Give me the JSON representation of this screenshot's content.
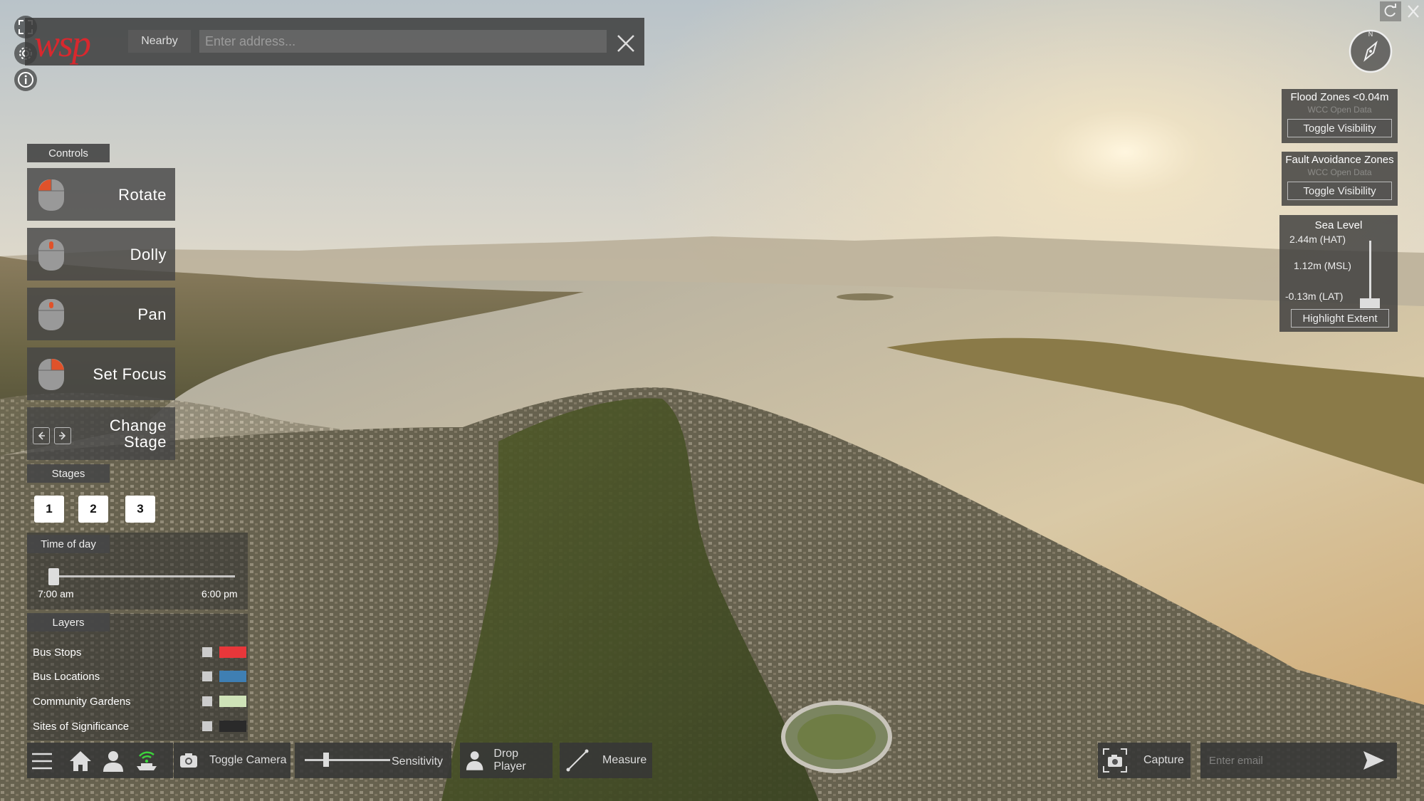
{
  "search": {
    "logo_text": "wsp",
    "nearby_label": "Nearby",
    "address_placeholder": "Enter address..."
  },
  "controls": {
    "section_label": "Controls",
    "items": [
      {
        "label": "Rotate"
      },
      {
        "label": "Dolly"
      },
      {
        "label": "Pan"
      },
      {
        "label": "Set Focus"
      },
      {
        "label_line1": "Change",
        "label_line2": "Stage"
      }
    ]
  },
  "stages": {
    "section_label": "Stages",
    "buttons": [
      "1",
      "2",
      "3"
    ]
  },
  "time_of_day": {
    "section_label": "Time of day",
    "start_label": "7:00 am",
    "end_label": "6:00 pm",
    "value_fraction": 0.0
  },
  "layers": {
    "section_label": "Layers",
    "items": [
      {
        "name": "Bus Stops",
        "color": "#e8373a"
      },
      {
        "name": "Bus Locations",
        "color": "#3f7fb3"
      },
      {
        "name": "Community Gardens",
        "color": "#cfe3b8"
      },
      {
        "name": "Sites of Significance",
        "color": "#2a2a2a"
      }
    ]
  },
  "toolbar": {
    "toggle_camera_label": "Toggle Camera",
    "sensitivity_label": "Sensitivity",
    "sensitivity_fraction": 0.25,
    "drop_player_label": "Drop Player",
    "measure_label": "Measure",
    "capture_label": "Capture",
    "email_placeholder": "Enter email"
  },
  "right_panels": {
    "flood": {
      "title": "Flood Zones <0.04m",
      "source": "WCC Open Data",
      "button": "Toggle Visibility"
    },
    "fault": {
      "title": "Fault Avoidance Zones",
      "source": "WCC Open Data",
      "button": "Toggle Visibility"
    },
    "sea_level": {
      "title": "Sea Level",
      "levels": [
        "2.44m (HAT)",
        "1.12m (MSL)",
        "-0.13m (LAT)"
      ],
      "button": "Highlight Extent",
      "value_fraction": 0.0
    }
  },
  "compass_letter": "N"
}
